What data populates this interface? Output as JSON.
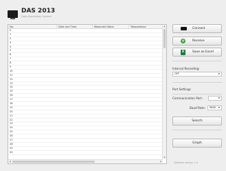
{
  "app": {
    "title": "DAS 2013",
    "subtitle": "Data Acquisition System"
  },
  "table": {
    "columns": [
      "No.",
      "Date and Time",
      "Measured Value",
      "Temperature"
    ],
    "rows": [
      "0",
      "1",
      "2",
      "3",
      "4",
      "5",
      "6",
      "7",
      "8",
      "9",
      "10",
      "11",
      "12",
      "13",
      "14",
      "15",
      "16",
      "17",
      "18",
      "19",
      "20",
      "21",
      "22",
      "23",
      "24",
      "25",
      "26",
      "27",
      "28",
      "29",
      "30"
    ]
  },
  "panel": {
    "connect_label": "Connect",
    "receive_label": "Receive",
    "save_excel_label": "Save as Excel",
    "interval_recording_label": "Interval Recording:",
    "interval_recording_value": "OFF",
    "port_settings_label": "Port Settings",
    "communication_port_label": "Communication Port:",
    "communication_port_value": "",
    "baud_rate_label": "Baud Rate:",
    "baud_rate_value": "9600",
    "search_label": "Search",
    "graph_label": "Graph"
  },
  "footer": {
    "version": "Software version 1.0"
  },
  "colors": {
    "background": "#eeeeee",
    "receive_icon": "#3aa33a",
    "excel_icon": "#1f7a35"
  },
  "icons": {
    "app": "monitor-icon",
    "connect": "connector-icon",
    "receive": "plus-circle-icon",
    "excel": "excel-icon"
  }
}
